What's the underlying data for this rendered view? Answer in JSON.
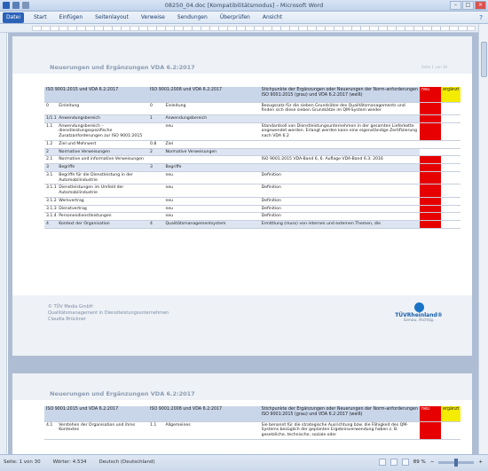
{
  "window": {
    "title": "08250_04.doc [Kompatibilitätsmodus] - Microsoft Word"
  },
  "ribbon": {
    "file_label": "Datei",
    "tabs": [
      "Start",
      "Einfügen",
      "Seitenlayout",
      "Verweise",
      "Sendungen",
      "Überprüfen",
      "Ansicht"
    ],
    "help_glyph": "?"
  },
  "header": {
    "title": "Neuerungen und Ergänzungen VDA 6.2:2017",
    "right_text": "Seite 1 von 30"
  },
  "table_head": {
    "col1": "ISO 9001:2015 und VDA 6.2:2017",
    "col2": "ISO 9001:2008 und VDA 6.2:2017",
    "col3": "Stichpunkte der Ergänzungen oder Neuerungen der Norm-anforderungen ISO 9001:2015 (grau) und VDA 6.2:2017 (weiß)",
    "col4": "neu",
    "col5": "ergänzt"
  },
  "rows": [
    {
      "n1": "0",
      "t1": "Einleitung",
      "n2": "0",
      "t2": "Einleitung",
      "note": "Bezugssatz für die sieben Grundsätze des Qualitätsmanagements und finden sich diese sieben Grundsätze im QM-System wieder",
      "flag": "red",
      "sec": false
    },
    {
      "n1": "1/1.1",
      "t1": "Anwendungsbereich",
      "n2": "1",
      "t2": "Anwendungsbereich",
      "note": "",
      "flag": "red",
      "sec": true
    },
    {
      "n1": "1.1",
      "t1": "Anwendungsbereich – dienstleistungsspezifische Zusatzanforderungen zur ISO 9001:2015",
      "n2": "",
      "t2": "neu",
      "note": "Standardsoll von Dienstleistungsunternehmen in der gesamten Lieferkette angewendet werden. Erlangt werden kann eine eigenständige Zertifizierung nach VDA 6.2",
      "flag": "red",
      "sec": false
    },
    {
      "n1": "1.2",
      "t1": "Ziel und Mehrwert",
      "n2": "0.8",
      "t2": "Ziel",
      "note": "",
      "flag": "white",
      "sec": false
    },
    {
      "n1": "2",
      "t1": "Normative Verweisungen",
      "n2": "2",
      "t2": "Normative Verweisungen",
      "note": "",
      "flag": "white",
      "sec": true
    },
    {
      "n1": "2.1",
      "t1": "Normative und informative Verweisungen",
      "n2": "",
      "t2": "",
      "note": "ISO 9001:2015 VDA-Band 6, 6. Auflage VDA-Band 6.3: 2016",
      "flag": "red",
      "sec": false
    },
    {
      "n1": "3",
      "t1": "Begriffe",
      "n2": "3",
      "t2": "Begriffe",
      "note": "",
      "flag": "red",
      "sec": true
    },
    {
      "n1": "3.1",
      "t1": "Begriffe für die Dienstleistung in der Automobilindustrie",
      "n2": "",
      "t2": "neu",
      "note": "Definition",
      "flag": "red",
      "sec": false
    },
    {
      "n1": "3.1.1",
      "t1": "Dienstleistungen im Umfeld der Automobilindustrie",
      "n2": "",
      "t2": "neu",
      "note": "Definition",
      "flag": "red",
      "sec": false
    },
    {
      "n1": "3.1.2",
      "t1": "Werkvertrag",
      "n2": "",
      "t2": "neu",
      "note": "Definition",
      "flag": "red",
      "sec": false
    },
    {
      "n1": "3.1.3",
      "t1": "Dienstvertrag",
      "n2": "",
      "t2": "neu",
      "note": "Definition",
      "flag": "red",
      "sec": false
    },
    {
      "n1": "3.1.4",
      "t1": "Personendienstleistungen",
      "n2": "",
      "t2": "neu",
      "note": "Definition",
      "flag": "red",
      "sec": false
    },
    {
      "n1": "4",
      "t1": "Kontext der Organisation",
      "n2": "4",
      "t2": "Qualitätsmanagementsystem",
      "note": "Ermittlung (muss) von internen und externen Themen, die",
      "flag": "red",
      "sec": true
    }
  ],
  "footer": {
    "lines": [
      "© TÜV Media GmbH",
      "Qualitätsmanagement in Dienstleistungsunternehmen",
      "Claudia Brückner"
    ],
    "brand": "TÜVRheinland®",
    "claim": "Genau. Richtig."
  },
  "page2": {
    "header_title": "Neuerungen und Ergänzungen VDA 6.2:2017",
    "row": {
      "n1": "4.1",
      "t1": "Verstehen der Organisation und ihres Kontextes",
      "n2": "1.1",
      "t2": "Allgemeines",
      "note": "Sie benannt für die strategische Ausrichtung bzw. die Fähigkeit des QM-Systems bezüglich der geplanten Ergebnisverwendung haben z. B. gesetzliche, technische, soziale oder"
    }
  },
  "status": {
    "page": "Seite: 1 von 30",
    "words": "Wörter: 4.534",
    "language": "Deutsch (Deutschland)",
    "zoom": "89 %"
  },
  "colors": {
    "neu": "#e60000",
    "ergaenzt": "#f4ec00",
    "word_blue": "#2a62b8"
  }
}
